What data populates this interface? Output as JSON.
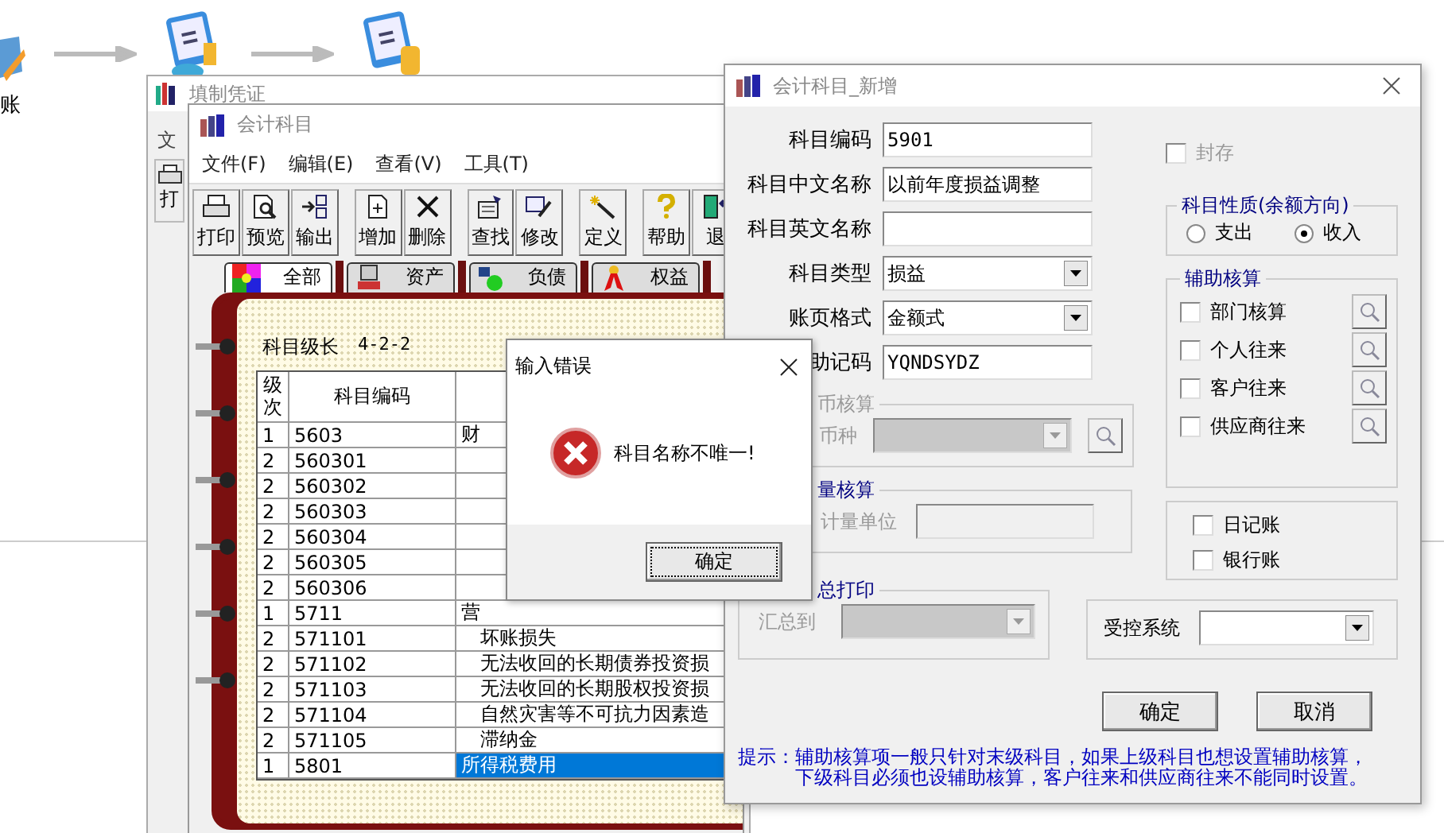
{
  "desktop": {
    "flow_label": "账"
  },
  "back_window": {
    "title": "填制凭证",
    "menu": [
      "文"
    ],
    "toolbar": [
      "打"
    ]
  },
  "subject_window": {
    "title": "会计科目",
    "menu": [
      "文件(F)",
      "编辑(E)",
      "查看(V)",
      "工具(T)"
    ],
    "toolbar": [
      {
        "kind": "print",
        "label": "打印",
        "separator_before": false
      },
      {
        "kind": "preview",
        "label": "预览",
        "separator_before": false
      },
      {
        "kind": "export",
        "label": "输出",
        "separator_before": false
      },
      {
        "kind": "add",
        "label": "增加",
        "separator_before": true
      },
      {
        "kind": "delete",
        "label": "删除",
        "separator_before": false
      },
      {
        "kind": "find",
        "label": "查找",
        "separator_before": true
      },
      {
        "kind": "edit",
        "label": "修改",
        "separator_before": false
      },
      {
        "kind": "define",
        "label": "定义",
        "separator_before": true
      },
      {
        "kind": "help",
        "label": "帮助",
        "separator_before": true
      },
      {
        "kind": "exit",
        "label": "退",
        "separator_before": false
      }
    ],
    "tabs": [
      {
        "kind": "all",
        "label": "全部",
        "selected": true
      },
      {
        "kind": "assets",
        "label": "资产",
        "selected": false
      },
      {
        "kind": "liabilities",
        "label": "负债",
        "selected": false
      },
      {
        "kind": "equity",
        "label": "权益",
        "selected": false
      }
    ],
    "level_label": "科目级长",
    "level_value": "4-2-2",
    "table": {
      "columns": [
        "级次",
        "科目编码"
      ],
      "rows": [
        {
          "level": "1",
          "code": "5603",
          "name": "财",
          "selected": false
        },
        {
          "level": "2",
          "code": "560301",
          "selected": false
        },
        {
          "level": "2",
          "code": "560302",
          "selected": false
        },
        {
          "level": "2",
          "code": "560303",
          "selected": false
        },
        {
          "level": "2",
          "code": "560304",
          "selected": false
        },
        {
          "level": "2",
          "code": "560305",
          "selected": false
        },
        {
          "level": "2",
          "code": "560306",
          "selected": false
        },
        {
          "level": "1",
          "code": "5711",
          "name": "营",
          "selected": false
        },
        {
          "level": "2",
          "code": "571101",
          "name": "坏账损失",
          "selected": false
        },
        {
          "level": "2",
          "code": "571102",
          "name": "无法收回的长期债券投资损",
          "selected": false
        },
        {
          "level": "2",
          "code": "571103",
          "name": "无法收回的长期股权投资损",
          "selected": false
        },
        {
          "level": "2",
          "code": "571104",
          "name": "自然灾害等不可抗力因素造",
          "selected": false
        },
        {
          "level": "2",
          "code": "571105",
          "name": "滞纳金",
          "selected": false
        },
        {
          "level": "1",
          "code": "5801",
          "name": "所得税费用",
          "selected": true
        }
      ]
    }
  },
  "error_dialog": {
    "title": "输入错误",
    "message": "科目名称不唯一!",
    "button": "确定"
  },
  "new_subject_dialog": {
    "title": "会计科目_新增",
    "fields": [
      {
        "kind": "text",
        "label": "科目编码",
        "value": "5901"
      },
      {
        "kind": "text",
        "label": "科目中文名称",
        "value": "以前年度损益调整"
      },
      {
        "kind": "text",
        "label": "科目英文名称"
      },
      {
        "kind": "select",
        "label": "科目类型",
        "value": "损益"
      },
      {
        "kind": "select",
        "label": "账页格式",
        "value": "金额式"
      },
      {
        "kind": "text",
        "label": "助记码",
        "value": "YQNDSYDZ"
      }
    ],
    "currency_group": {
      "legend": "币核算",
      "label": "币种",
      "disabled": true
    },
    "quantity_group": {
      "legend": "量核算",
      "label": "计量单位",
      "disabled": true
    },
    "summary_group": {
      "legend": "总打印",
      "label": "汇总到",
      "disabled": true
    },
    "seal": {
      "label": "封存",
      "checked": false,
      "disabled": true
    },
    "nature": {
      "legend": "科目性质(余额方向)",
      "options": [
        {
          "label": "支出",
          "selected": false
        },
        {
          "label": "收入",
          "selected": true
        }
      ]
    },
    "aux": {
      "legend": "辅助核算",
      "items": [
        {
          "label": "部门核算",
          "checked": false
        },
        {
          "label": "个人往来",
          "checked": false
        },
        {
          "label": "客户往来",
          "checked": false
        },
        {
          "label": "供应商往来",
          "checked": false
        }
      ]
    },
    "books": [
      {
        "label": "日记账",
        "checked": false
      },
      {
        "label": "银行账",
        "checked": false
      }
    ],
    "control_system": {
      "label": "受控系统"
    },
    "buttons": [
      "确定",
      "取消"
    ],
    "hint_lines": [
      "提示：辅助核算项一般只针对末级科目，如果上级科目也想设置辅助核算，",
      "下级科目必须也设辅助核算，客户往来和供应商往来不能同时设置。"
    ]
  }
}
